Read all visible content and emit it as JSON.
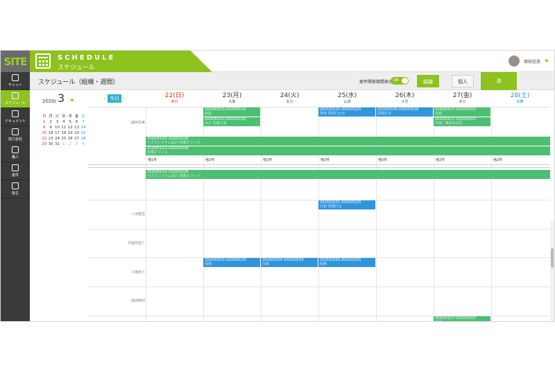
{
  "header": {
    "logo": "SITE",
    "brand_en": "SCHEDULE",
    "brand_jp": "スケジュール",
    "user_name": "面田信美"
  },
  "sidebar": {
    "items": [
      {
        "label": "チャット",
        "icon": "chat-icon",
        "active": false
      },
      {
        "label": "スケジュール",
        "icon": "calendar-icon",
        "active": true
      },
      {
        "label": "ドキュメント",
        "icon": "document-icon",
        "active": false
      },
      {
        "label": "協力会社",
        "icon": "partner-icon",
        "active": false
      },
      {
        "label": "職人",
        "icon": "worker-icon",
        "active": false
      },
      {
        "label": "案件",
        "icon": "project-icon",
        "active": false
      },
      {
        "label": "施主",
        "icon": "owner-icon",
        "active": false
      }
    ]
  },
  "toolbar": {
    "title": "スケジュール（組織・週間）",
    "toggle_label": "案件関係期間表示",
    "toggle_state": "ON",
    "btn_org": "組織",
    "btn_individual": "個人",
    "btn_week": "週"
  },
  "minical": {
    "year": "2020/",
    "month": "3",
    "weekdays": [
      "日",
      "月",
      "火",
      "水",
      "木",
      "金",
      "土"
    ],
    "weeks": [
      [
        "1",
        "2",
        "3",
        "4",
        "5",
        "6",
        "7"
      ],
      [
        "8",
        "9",
        "10",
        "11",
        "12",
        "13",
        "14"
      ],
      [
        "15",
        "16",
        "17",
        "18",
        "19",
        "20",
        "21"
      ],
      [
        "22",
        "23",
        "24",
        "25",
        "26",
        "27",
        "28"
      ],
      [
        "29",
        "30",
        "31",
        "1",
        "2",
        "3",
        "4"
      ]
    ]
  },
  "week": {
    "today_label": "今日",
    "prev": "‹",
    "next": "›",
    "days": [
      {
        "date": "22(日)",
        "rokuyo": "赤口"
      },
      {
        "date": "23(月)",
        "rokuyo": "先勝"
      },
      {
        "date": "24(火)",
        "rokuyo": "友引"
      },
      {
        "date": "25(水)",
        "rokuyo": "仏滅"
      },
      {
        "date": "26(木)",
        "rokuyo": "大安"
      },
      {
        "date": "27(金)",
        "rokuyo": "赤口"
      },
      {
        "date": "28(土)",
        "rokuyo": "先勝"
      }
    ]
  },
  "rows": {
    "r1": "面田信美",
    "r3": "八洲重信",
    "r4": "早稲田直仁",
    "r5": "川瀬佳介",
    "r6": "堀田郁利"
  },
  "events": {
    "e1": {
      "range": "2020/03/23-2020/03/23",
      "sub": "仮設"
    },
    "e2": {
      "range": "2020/03/23-2020/03/23",
      "sub": "木工 内装工事"
    },
    "e3": {
      "range": "2020/03/25-2020/03/25",
      "sub": "現地 現場打合せ"
    },
    "e4": {
      "range": "2020/03/26-2020/03/26",
      "sub": "現場打合"
    },
    "e5": {
      "range": "2020/03/27-2020/03/27",
      "sub": "内装"
    },
    "e6": {
      "range": "2020/03/27-2020/03/27",
      "sub": "外装 / 東京中央区"
    },
    "e7": {
      "range": "2020/03/22-2020/03/28",
      "sub": "イズミシステム設計 高橋オフィス"
    },
    "e8": {
      "range": "2020/03/22-2020/03/28",
      "sub": "高橋オフィス"
    },
    "e9": {
      "range": "2020/03/22-2020/03/28",
      "sub": "イズミシステム設計 高橋オフィス"
    },
    "e10": {
      "range": "2020/03/25-2020/03/25",
      "sub": "内装 現場打合"
    },
    "e11": {
      "range": "2020/03/23-2020/03/23",
      "sub": "現場"
    },
    "e12": {
      "range": "2020/03/24-2020/03/24",
      "sub": "内装"
    },
    "e13": {
      "range": "2020/03/25-2020/03/25",
      "sub": "現場"
    },
    "e14": {
      "range": "2020/03/27-2020/03/27",
      "sub": "内装"
    }
  },
  "others": {
    "o22": "他1件",
    "o23": "他2件",
    "o24": "他2件",
    "o25": "他2件",
    "o26": "他2件",
    "o27": "他2件",
    "o28": "他2件"
  },
  "colors": {
    "accent": "#8dc21f",
    "event_green": "#4cbf73",
    "event_blue": "#2f96dc",
    "sidebar": "#3a3a3a"
  }
}
